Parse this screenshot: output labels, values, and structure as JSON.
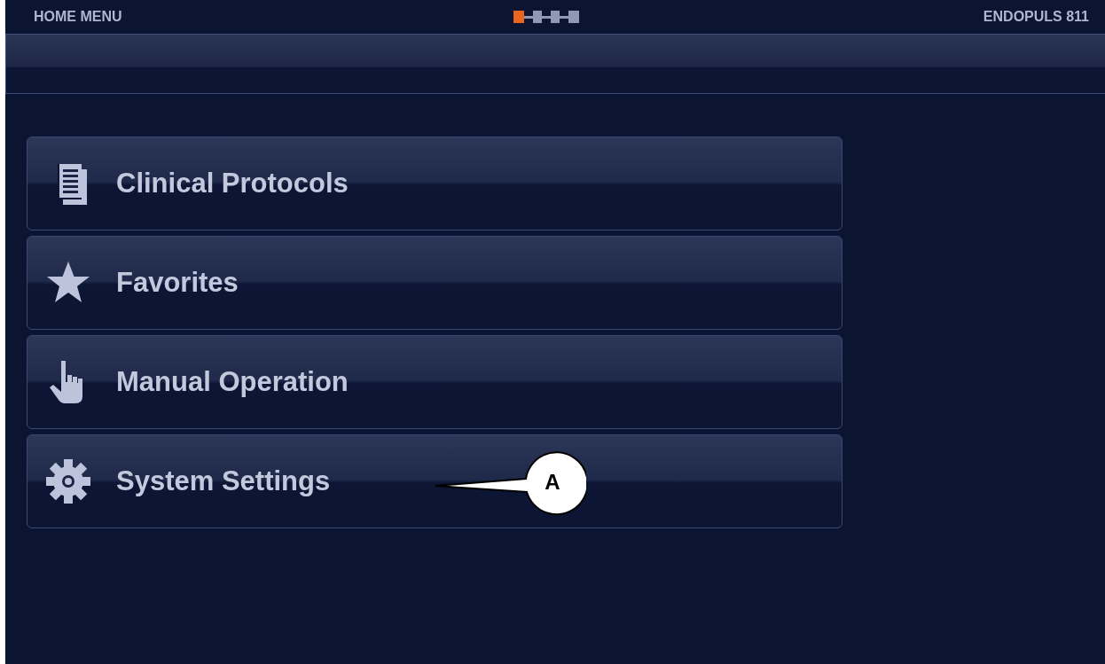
{
  "header": {
    "title": "HOME MENU",
    "device": "ENDOPULS 811"
  },
  "menu": [
    {
      "kind": "protocols",
      "label": "Clinical Protocols"
    },
    {
      "kind": "favorites",
      "label": "Favorites"
    },
    {
      "kind": "manual",
      "label": "Manual Operation"
    },
    {
      "kind": "settings",
      "label": "System Settings"
    }
  ],
  "callout": {
    "label": "A"
  }
}
